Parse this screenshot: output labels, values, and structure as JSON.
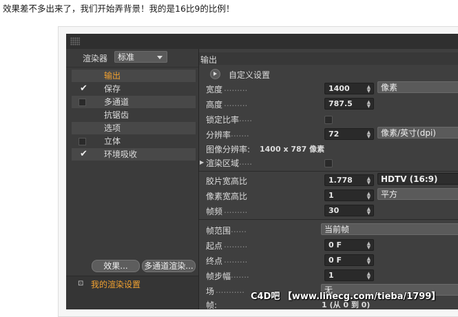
{
  "caption": "效果差不多出来了，我们开始弄背景！我的是16比9的比例！",
  "left": {
    "renderer_label": "渲染器",
    "renderer_value": "标准",
    "items": [
      {
        "label": "输出",
        "state": "selected"
      },
      {
        "label": "保存",
        "state": "checked"
      },
      {
        "label": "多通道",
        "state": "unchecked"
      },
      {
        "label": "抗锯齿",
        "state": "none"
      },
      {
        "label": "选项",
        "state": "none"
      },
      {
        "label": "立体",
        "state": "unchecked"
      },
      {
        "label": "环境吸收",
        "state": "checked"
      }
    ],
    "effects_button": "效果...",
    "multipass_button": "多通道渲染...",
    "render_setting": "我的渲染设置"
  },
  "right": {
    "header": "输出",
    "custom": "自定义设置",
    "width_label": "宽度",
    "width_value": "1400",
    "width_unit": "像素",
    "height_label": "高度",
    "height_value": "787.5",
    "lock_label": "锁定比率",
    "res_label": "分辨率",
    "res_value": "72",
    "res_unit": "像素/英寸(dpi)",
    "imgres_label": "图像分辨率:",
    "imgres_value": "1400 x 787 像素",
    "region_label": "渲染区域",
    "film_label": "胶片宽高比",
    "film_value": "1.778",
    "film_preset": "HDTV (16:9)",
    "pixel_label": "像素宽高比",
    "pixel_value": "1",
    "pixel_preset": "平方",
    "fps_label": "帧频",
    "fps_value": "30",
    "range_label": "帧范围",
    "range_value": "当前帧",
    "start_label": "起点",
    "start_value": "0 F",
    "end_label": "终点",
    "end_value": "0 F",
    "step_label": "帧步幅",
    "step_value": "1",
    "field_label": "场",
    "field_value": "无",
    "frames_label": "帧:",
    "frames_value": "1 (从 0 到 0)"
  },
  "watermark": "C4D吧 【www.linecg.com/tieba/1799】"
}
